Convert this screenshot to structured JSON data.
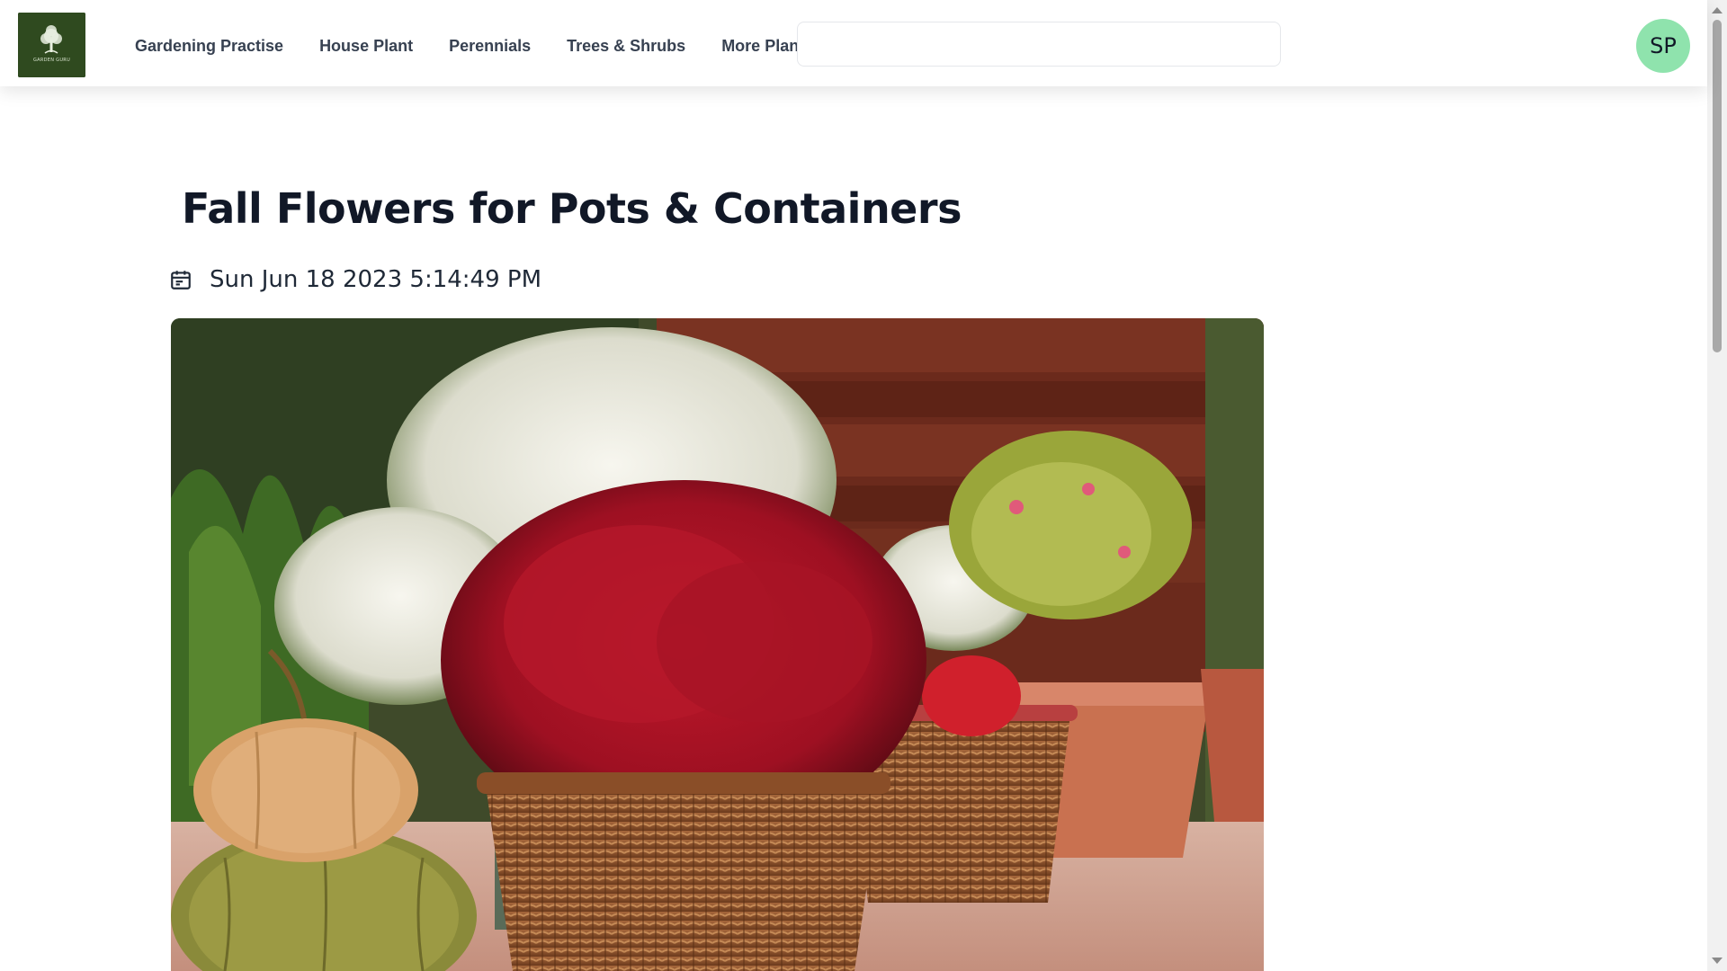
{
  "brand": {
    "logo_text": "GARDEN GURU"
  },
  "nav": {
    "links": [
      {
        "label": "Gardening Practise"
      },
      {
        "label": "House Plant"
      },
      {
        "label": "Perennials"
      },
      {
        "label": "Trees & Shrubs"
      },
      {
        "label": "More Plants"
      }
    ]
  },
  "search": {
    "value": "",
    "placeholder": ""
  },
  "user": {
    "initials": "SP"
  },
  "article": {
    "title": "Fall Flowers for Pots & Containers",
    "date": "Sun Jun 18 2023 5:14:49 PM"
  },
  "colors": {
    "avatar": "#8fe3ad",
    "logo_bg": "#2f4a1f"
  }
}
